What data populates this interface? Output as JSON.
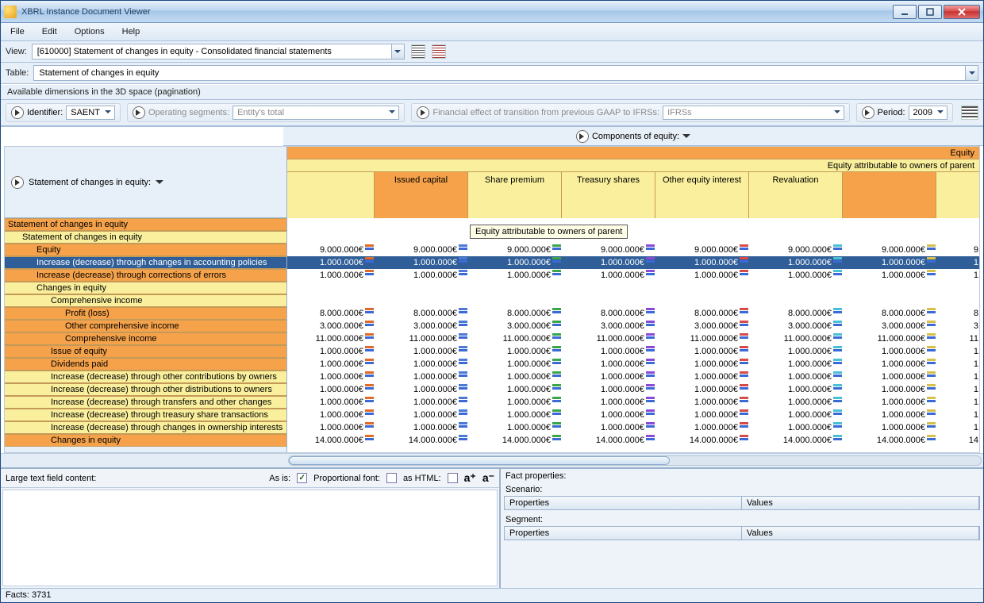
{
  "window": {
    "title": "XBRL Instance Document Viewer"
  },
  "menu": {
    "file": "File",
    "edit": "Edit",
    "options": "Options",
    "help": "Help"
  },
  "viewrow": {
    "label": "View:",
    "value": "[610000] Statement of changes in equity - Consolidated financial statements"
  },
  "tablerow": {
    "label": "Table:",
    "value": "Statement of changes in equity"
  },
  "dim_header": "Available dimensions in the 3D space (pagination)",
  "dims": {
    "identifier": {
      "label": "Identifier:",
      "value": "SAENT"
    },
    "opseg": {
      "label": "Operating segments:",
      "value": "Entity's total"
    },
    "gaap": {
      "label": "Financial effect of transition from previous GAAP to IFRSs:",
      "value": "IFRSs"
    },
    "period": {
      "label": "Period:",
      "value": "2009"
    }
  },
  "colaxis_label": "Components of equity:",
  "rowaxis_label": "Statement of changes in equity:",
  "tooltip": "Equity attributable to owners of parent",
  "col_top": "Equity",
  "col_sub": "Equity attributable to owners of parent",
  "columns": [
    "Issued capital",
    "Share premium",
    "Treasury shares",
    "Other equity interest",
    "Revaluation"
  ],
  "rows": [
    {
      "label": "Statement of changes in equity",
      "cls": "or",
      "ind": 0
    },
    {
      "label": "Statement of changes in equity",
      "cls": "ye",
      "ind": 1
    },
    {
      "label": "Equity",
      "cls": "or",
      "ind": 2
    },
    {
      "label": "Increase (decrease) through changes in accounting policies",
      "cls": "sel",
      "ind": 2
    },
    {
      "label": "Increase (decrease) through corrections of errors",
      "cls": "or",
      "ind": 2
    },
    {
      "label": "Changes in equity",
      "cls": "ye",
      "ind": 2
    },
    {
      "label": "Comprehensive income",
      "cls": "ye",
      "ind": 3
    },
    {
      "label": "Profit (loss)",
      "cls": "or",
      "ind": 4
    },
    {
      "label": "Other comprehensive income",
      "cls": "or",
      "ind": 4
    },
    {
      "label": "Comprehensive income",
      "cls": "or",
      "ind": 4
    },
    {
      "label": "Issue of equity",
      "cls": "or",
      "ind": 3
    },
    {
      "label": "Dividends paid",
      "cls": "or",
      "ind": 3
    },
    {
      "label": "Increase (decrease) through other contributions by owners",
      "cls": "ye",
      "ind": 3
    },
    {
      "label": "Increase (decrease) through other distributions to owners",
      "cls": "ye",
      "ind": 3
    },
    {
      "label": "Increase (decrease) through transfers and other changes",
      "cls": "ye",
      "ind": 3
    },
    {
      "label": "Increase (decrease) through treasury share transactions",
      "cls": "ye",
      "ind": 3
    },
    {
      "label": "Increase (decrease) through changes in ownership interests",
      "cls": "ye",
      "ind": 3
    },
    {
      "label": "Changes in equity",
      "cls": "or",
      "ind": 3
    }
  ],
  "values": {
    "v9": "9.000.000€",
    "v1": "1.000.000€",
    "v8": "8.000.000€",
    "v3": "3.000.000€",
    "v11": "11.000.000€",
    "v14": "14.000.000€",
    "t9": "9.",
    "t1": "1.",
    "t8": "8.",
    "t3": "3.",
    "t11": "11.",
    "t14": "14."
  },
  "datarows": [
    null,
    null,
    {
      "v": "v9",
      "t": "t9"
    },
    {
      "v": "v1",
      "t": "t1",
      "sel": true
    },
    {
      "v": "v1",
      "t": "t1"
    },
    null,
    null,
    {
      "v": "v8",
      "t": "t8"
    },
    {
      "v": "v3",
      "t": "t3"
    },
    {
      "v": "v11",
      "t": "t11"
    },
    {
      "v": "v1",
      "t": "t1"
    },
    {
      "v": "v1",
      "t": "t1"
    },
    {
      "v": "v1",
      "t": "t1"
    },
    {
      "v": "v1",
      "t": "t1"
    },
    {
      "v": "v1",
      "t": "t1"
    },
    {
      "v": "v1",
      "t": "t1"
    },
    {
      "v": "v1",
      "t": "t1"
    },
    {
      "v": "v14",
      "t": "t14"
    }
  ],
  "bottom": {
    "large_label": "Large text field content:",
    "asis": "As is:",
    "propfont": "Proportional font:",
    "ashtml": "as HTML:",
    "aplus": "a⁺",
    "aminus": "a⁻",
    "fact_props": "Fact properties:",
    "scenario": "Scenario:",
    "segment": "Segment:",
    "properties": "Properties",
    "valuescol": "Values"
  },
  "status": "Facts: 3731"
}
